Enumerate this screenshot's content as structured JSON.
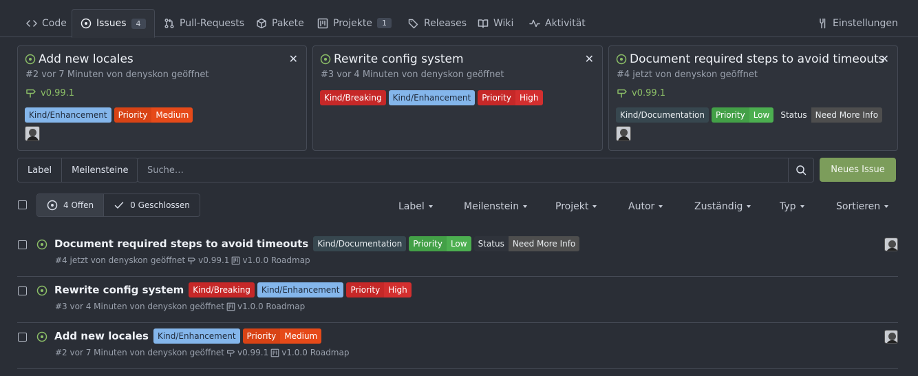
{
  "tabs": [
    {
      "label": "Code"
    },
    {
      "label": "Issues",
      "count": "4"
    },
    {
      "label": "Pull-Requests"
    },
    {
      "label": "Pakete"
    },
    {
      "label": "Projekte",
      "count": "1"
    },
    {
      "label": "Releases"
    },
    {
      "label": "Wiki"
    },
    {
      "label": "Aktivität"
    },
    {
      "label": "Einstellungen"
    }
  ],
  "pinned": [
    {
      "title": "Add new locales",
      "meta": "#2 vor 7 Minuten von denyskon geöffnet",
      "milestone": "v0.99.1",
      "labels": [
        [
          "Kind/Enhancement"
        ],
        [
          "Priority",
          "Medium"
        ]
      ]
    },
    {
      "title": "Rewrite config system",
      "meta": "#3 vor 4 Minuten von denyskon geöffnet",
      "labels": [
        [
          "Kind/Breaking"
        ],
        [
          "Kind/Enhancement"
        ],
        [
          "Priority",
          "High"
        ]
      ]
    },
    {
      "title": "Document required steps to avoid timeouts",
      "meta": "#4 jetzt von denyskon geöffnet",
      "milestone": "v0.99.1",
      "labels": [
        [
          "Kind/Documentation"
        ],
        [
          "Priority",
          "Low"
        ],
        [
          "Status",
          "Need More Info"
        ]
      ]
    }
  ],
  "filters": {
    "label_btn": "Label",
    "milestones_btn": "Meilensteine",
    "search_placeholder": "Suche…",
    "new_issue": "Neues Issue",
    "open_count": "4 Offen",
    "closed_count": "0 Geschlossen",
    "dropdowns": [
      "Label",
      "Meilenstein",
      "Projekt",
      "Autor",
      "Zuständig",
      "Typ",
      "Sortieren"
    ]
  },
  "issues": [
    {
      "title": "Document required steps to avoid timeouts",
      "meta": "#4 jetzt von denyskon geöffnet",
      "milestone": "v0.99.1",
      "project": "v1.0.0 Roadmap",
      "labels": [
        [
          "Kind/Documentation"
        ],
        [
          "Priority",
          "Low"
        ],
        [
          "Status",
          "Need More Info"
        ]
      ]
    },
    {
      "title": "Rewrite config system",
      "meta": "#3 vor 4 Minuten von denyskon geöffnet",
      "project": "v1.0.0 Roadmap",
      "labels": [
        [
          "Kind/Breaking"
        ],
        [
          "Kind/Enhancement"
        ],
        [
          "Priority",
          "High"
        ]
      ]
    },
    {
      "title": "Add new locales",
      "meta": "#2 vor 7 Minuten von denyskon geöffnet",
      "milestone": "v0.99.1",
      "project": "v1.0.0 Roadmap",
      "labels": [
        [
          "Kind/Enhancement"
        ],
        [
          "Priority",
          "Medium"
        ]
      ]
    }
  ],
  "colors": {
    "kind_enhancement": "#84b6eb",
    "kind_breaking": "#c62828",
    "kind_documentation": "#37474f",
    "priority_medium_scope": "#d84315",
    "priority_medium": "#e64a19",
    "priority_high_scope": "#c62828",
    "priority_high": "#d32f2f",
    "priority_low_scope": "#43a047",
    "priority_low": "#4caf50",
    "status_scope": "#2f333b",
    "status_value": "#4e4e4e",
    "open": "#8cbf67",
    "new_issue": "#7c9d5b"
  }
}
